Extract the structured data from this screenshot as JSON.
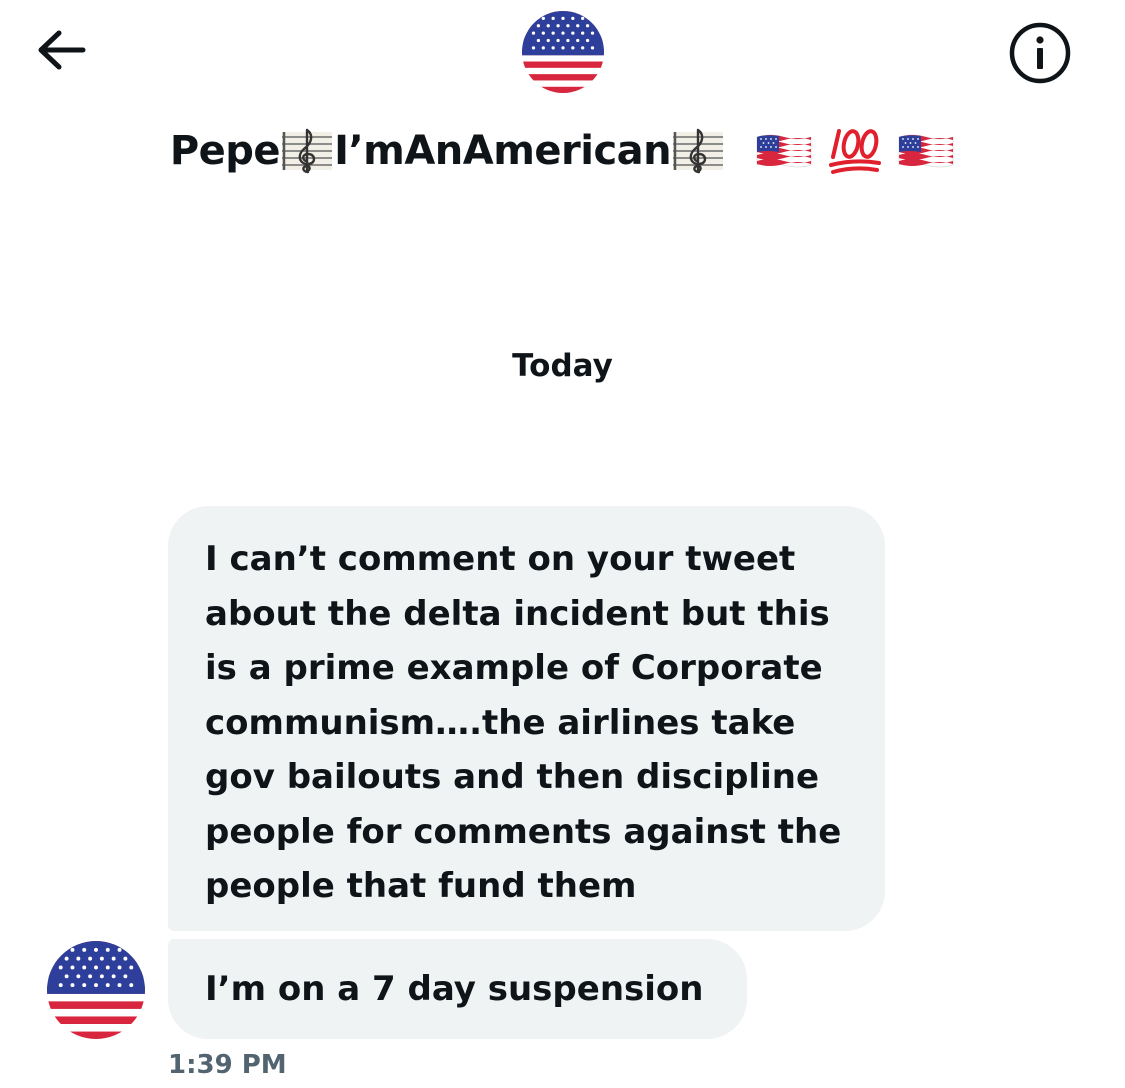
{
  "header": {
    "back_label": "Back",
    "info_label": "Conversation info",
    "avatar_icon": "us-flag-avatar",
    "title_name": "Pepe ",
    "title_handle_core": "I’mAnAmerican",
    "title_icons": [
      "musical-score-icon",
      "musical-score-icon",
      "us-flag-icon",
      "hundred-points-icon",
      "us-flag-icon"
    ]
  },
  "conversation": {
    "day_label": "Today",
    "messages": [
      {
        "text": "I can’t comment on your tweet about the delta incident but this is a prime example of Corporate communism….the airlines take gov bailouts and then discipline people for comments against the people that fund them"
      },
      {
        "text": "I’m on a 7 day suspension"
      }
    ],
    "timestamp": "1:39 PM",
    "sender_avatar_icon": "us-flag-avatar"
  },
  "colors": {
    "text_primary": "#0f1419",
    "text_secondary": "#536471",
    "bubble_bg": "#eff3f4",
    "flag_red": "#d7263d",
    "flag_blue": "#2d3f9a",
    "hundred_red": "#e0202c"
  }
}
